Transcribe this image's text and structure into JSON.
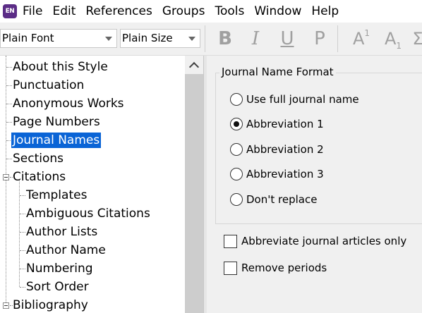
{
  "app": {
    "icon_text": "EN"
  },
  "menu": [
    "File",
    "Edit",
    "References",
    "Groups",
    "Tools",
    "Window",
    "Help"
  ],
  "toolbar": {
    "font_value": "Plain Font",
    "size_value": "Plain Size",
    "bold": "B",
    "italic": "I",
    "underline": "U",
    "plain": "P",
    "superscript": "A",
    "superscript_mark": "1",
    "subscript": "A",
    "subscript_mark": "1",
    "symbol": "Σ"
  },
  "tree": {
    "items": [
      "About this Style",
      "Punctuation",
      "Anonymous Works",
      "Page Numbers",
      "Journal Names",
      "Sections",
      "Citations",
      "Templates",
      "Ambiguous Citations",
      "Author Lists",
      "Author Name",
      "Numbering",
      "Sort Order",
      "Bibliography"
    ],
    "selected": "Journal Names"
  },
  "journal_format": {
    "title": "Journal Name Format",
    "options": [
      {
        "label": "Use full journal name",
        "checked": false
      },
      {
        "label": "Abbreviation 1",
        "checked": true
      },
      {
        "label": "Abbreviation 2",
        "checked": false
      },
      {
        "label": "Abbreviation 3",
        "checked": false
      },
      {
        "label": "Don't replace",
        "checked": false
      }
    ]
  },
  "checkboxes": [
    {
      "label": "Abbreviate journal articles only",
      "checked": false
    },
    {
      "label": "Remove periods",
      "checked": false
    }
  ],
  "colors": {
    "selection": "#0a64d6",
    "app_icon": "#5b2c86"
  }
}
